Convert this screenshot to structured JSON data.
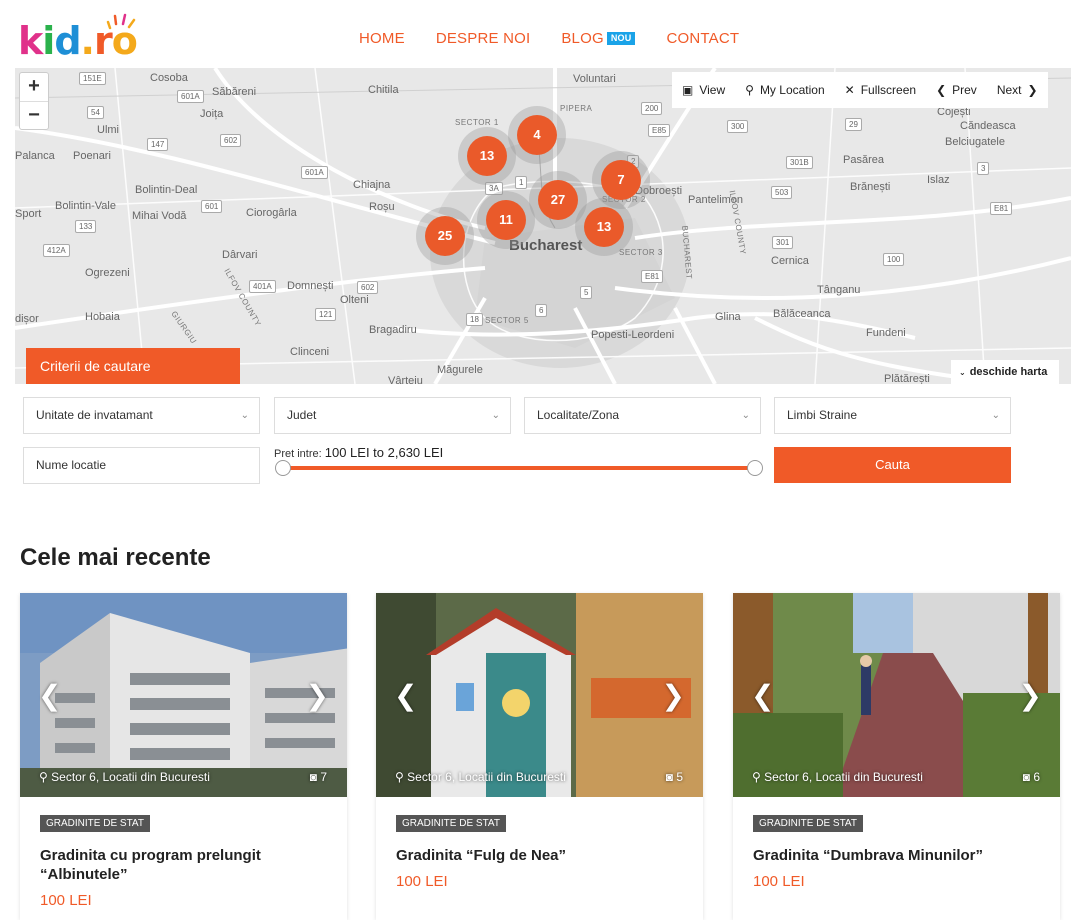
{
  "header": {
    "logo_text": {
      "k": "k",
      "i": "i",
      "d": "d",
      "dot": ".",
      "r": "r",
      "o": "o"
    },
    "nav": [
      {
        "label": "HOME"
      },
      {
        "label": "DESPRE NOI"
      },
      {
        "label": "BLOG",
        "badge": "NOU"
      },
      {
        "label": "CONTACT"
      }
    ]
  },
  "map": {
    "zoom_in": "+",
    "zoom_out": "−",
    "controls": {
      "view": "View",
      "my_location": "My Location",
      "fullscreen": "Fullscreen",
      "prev": "Prev",
      "next": "Next"
    },
    "clusters": [
      "13",
      "4",
      "7",
      "27",
      "11",
      "13",
      "25"
    ],
    "labels": {
      "cosoba": "Cosoba",
      "sabareni": "Săbăreni",
      "ulmi": "Ulmi",
      "joita": "Joița",
      "palanca": "Palanca",
      "poenari": "Poenari",
      "chitila": "Chitila",
      "voluntari": "Voluntari",
      "pipera": "PIPERA",
      "sector1": "SECTOR 1",
      "cojesti": "Cojești",
      "candeasca": "Căndeasca",
      "belciugatele": "Belciugatele",
      "pasarea": "Pasărea",
      "branesti": "Brănești",
      "islaz": "Islaz",
      "bolintin_deal": "Bolintin-Deal",
      "bolintin_vale": "Bolintin-Vale",
      "sport": "Sport",
      "mihai_voda": "Mihai Vodă",
      "chiajna": "Chiajna",
      "rosu": "Roșu",
      "ciorogarla": "Ciorogârla",
      "dobroesti": "Dobroești",
      "pantelimon": "Pantelimon",
      "sector2": "SECTOR 2",
      "bucharest": "Bucharest",
      "sector3": "SECTOR 3",
      "darvari": "Dârvari",
      "ogrezeni": "Ogrezeni",
      "domnesti": "Domnești",
      "olteni": "Olteni",
      "cernica": "Cernica",
      "tanganu": "Tânganu",
      "hobaia": "Hobaia",
      "bragadiru": "Bragadiru",
      "sector5": "SECTOR 5",
      "glina": "Glina",
      "balaceanca": "Bălăceanca",
      "popesti": "Popesti-Leordeni",
      "fundeni": "Fundeni",
      "clinceni": "Clinceni",
      "magurele": "Măgurele",
      "vartejiu": "Vârteju",
      "plataresti": "Plătărești",
      "ilfov_county": "ILFOV COUNTY",
      "ilfov_county2": "ILFOV COUNTY",
      "disor": "dișor",
      "bucharest_road": "BUCHAREST",
      "giurgiu": "GIURGIU"
    },
    "roads": [
      "151E",
      "601A",
      "54",
      "602",
      "147",
      "601A",
      "601",
      "133",
      "412A",
      "401A",
      "602",
      "121",
      "18",
      "6",
      "300",
      "29",
      "E85",
      "200",
      "E81",
      "301B",
      "503",
      "3",
      "301",
      "100",
      "E81",
      "3A",
      "1",
      "2",
      "5"
    ],
    "criteria_button": "Criterii de cautare",
    "open_map": "deschide harta"
  },
  "search": {
    "unit": "Unitate de invatamant",
    "county": "Judet",
    "locality": "Localitate/Zona",
    "languages": "Limbi Straine",
    "name_placeholder": "Nume locatie",
    "price_prefix": "Pret intre:",
    "price_range": "100 LEI to 2,630 LEI",
    "price_min_fraction": 0,
    "price_max_fraction": 1,
    "submit": "Cauta"
  },
  "recent": {
    "title": "Cele mai recente",
    "cards": [
      {
        "location": "Sector 6, Locatii din Bucuresti",
        "photos": "7",
        "tag": "GRADINITE DE STAT",
        "title": "Gradinita cu program prelungit “Albinutele”",
        "price": "100 LEI"
      },
      {
        "location": "Sector 6, Locatii din Bucuresti",
        "photos": "5",
        "tag": "GRADINITE DE STAT",
        "title": "Gradinita “Fulg de Nea”",
        "price": "100 LEI"
      },
      {
        "location": "Sector 6, Locatii din Bucuresti",
        "photos": "6",
        "tag": "GRADINITE DE STAT",
        "title": "Gradinita “Dumbrava Minunilor”",
        "price": "100 LEI"
      }
    ]
  },
  "colors": {
    "accent": "#f05a28",
    "badge": "#1aa3e8",
    "tag": "#555555"
  }
}
